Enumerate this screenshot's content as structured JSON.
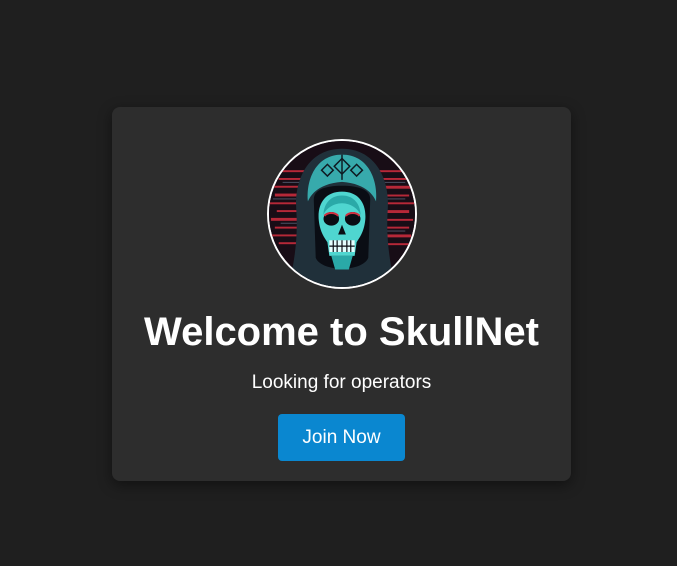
{
  "card": {
    "avatar_alt": "hooded skull avatar",
    "title": "Welcome to SkullNet",
    "subtitle": "Looking for operators",
    "join_label": "Join Now"
  },
  "colors": {
    "background": "#1f1f1f",
    "card": "#2d2d2d",
    "button": "#0a87d0",
    "text": "#ffffff",
    "skull_accent": "#3fd3d3",
    "glitch_red": "#d23040"
  }
}
